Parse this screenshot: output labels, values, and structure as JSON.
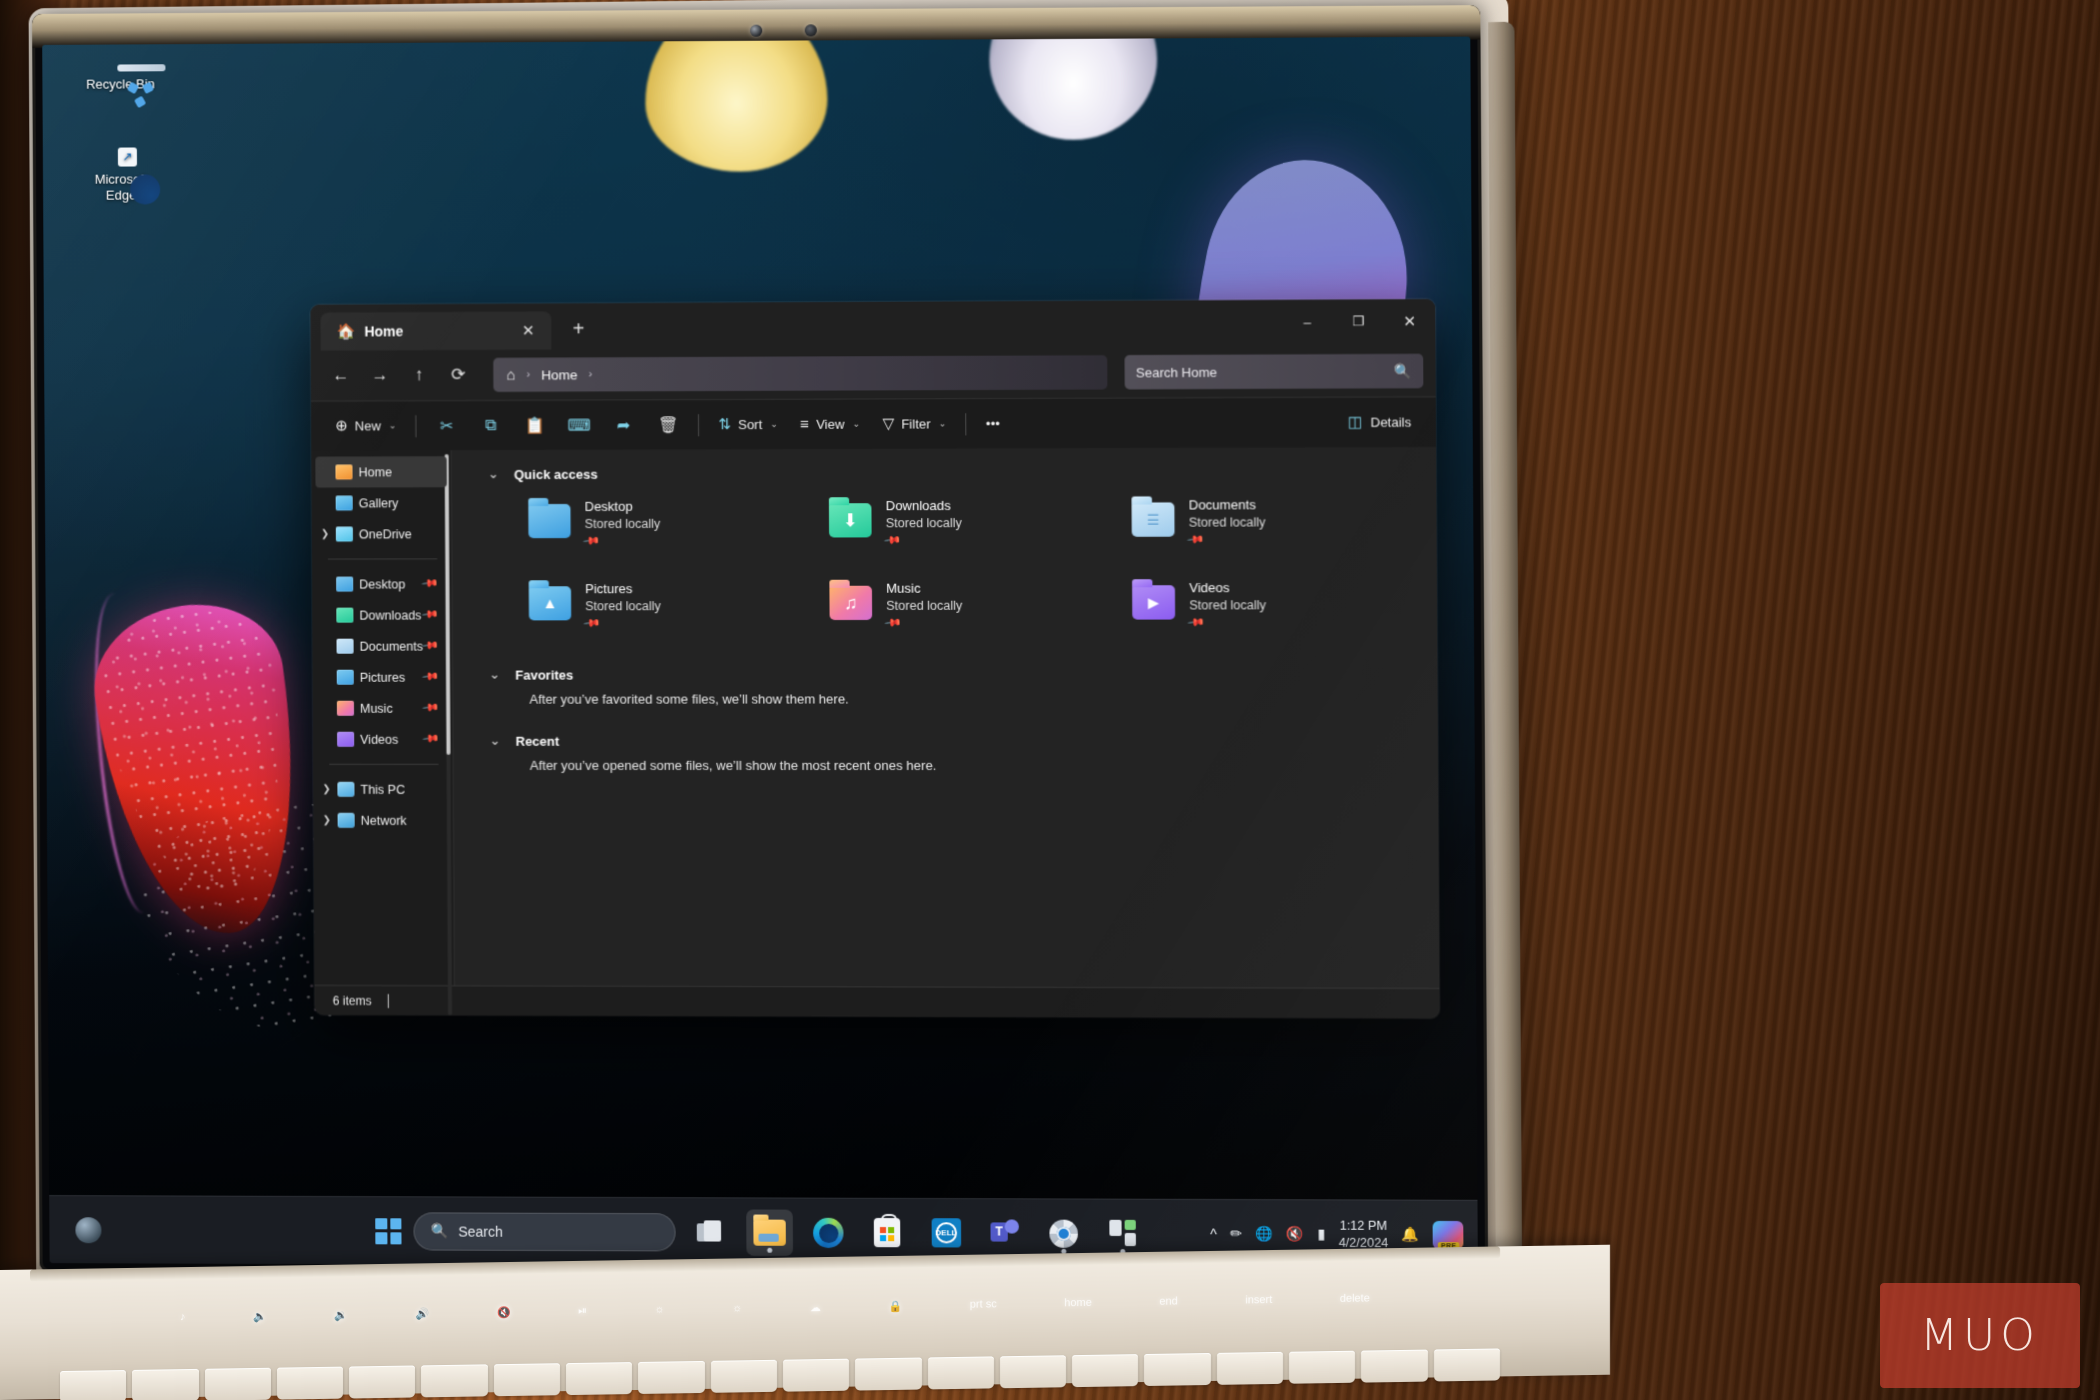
{
  "desktop": {
    "icons": [
      {
        "label": "Recycle Bin",
        "icon": "recycle-bin-icon"
      },
      {
        "label": "Microsoft\nEdge",
        "label_line1": "Microsoft",
        "label_line2": "Edge",
        "icon": "edge-icon"
      }
    ]
  },
  "explorer": {
    "tab": {
      "title": "Home",
      "icon": "home-icon",
      "close_label": "✕",
      "new_tab_label": "+"
    },
    "window_controls": {
      "minimize": "–",
      "maximize": "❐",
      "close": "✕"
    },
    "nav": {
      "back": "←",
      "forward": "→",
      "up": "↑",
      "refresh": "⟳",
      "breadcrumb_home_icon": "home-icon",
      "breadcrumb_sep1": "›",
      "breadcrumb_label": "Home",
      "breadcrumb_sep2": "›"
    },
    "search": {
      "placeholder": "Search Home",
      "icon": "search-icon"
    },
    "toolbar": {
      "new_label": "New",
      "new_icon": "plus-circle-icon",
      "cut_icon": "scissors-icon",
      "copy_icon": "copy-icon",
      "paste_icon": "clipboard-icon",
      "rename_icon": "rename-icon",
      "share_icon": "share-icon",
      "delete_icon": "trash-icon",
      "sort_label": "Sort",
      "sort_icon": "sort-arrows-icon",
      "view_label": "View",
      "view_icon": "view-list-icon",
      "filter_label": "Filter",
      "filter_icon": "funnel-icon",
      "more_label": "•••",
      "details_label": "Details",
      "details_icon": "details-pane-icon",
      "chevron": "⌄"
    },
    "sidebar": [
      {
        "label": "Home",
        "icon": "home-icon",
        "selected": true,
        "expandable": false,
        "pinned": false
      },
      {
        "label": "Gallery",
        "icon": "gallery-icon",
        "selected": false,
        "expandable": false,
        "pinned": false
      },
      {
        "label": "OneDrive",
        "icon": "onedrive-icon",
        "selected": false,
        "expandable": true,
        "pinned": false
      },
      {
        "label": "Desktop",
        "icon": "folder-desktop-icon",
        "selected": false,
        "expandable": false,
        "pinned": true
      },
      {
        "label": "Downloads",
        "icon": "folder-downloads-icon",
        "selected": false,
        "expandable": false,
        "pinned": true
      },
      {
        "label": "Documents",
        "icon": "folder-documents-icon",
        "selected": false,
        "expandable": false,
        "pinned": true
      },
      {
        "label": "Pictures",
        "icon": "folder-pictures-icon",
        "selected": false,
        "expandable": false,
        "pinned": true
      },
      {
        "label": "Music",
        "icon": "folder-music-icon",
        "selected": false,
        "expandable": false,
        "pinned": true
      },
      {
        "label": "Videos",
        "icon": "folder-videos-icon",
        "selected": false,
        "expandable": false,
        "pinned": true
      },
      {
        "label": "This PC",
        "icon": "this-pc-icon",
        "selected": false,
        "expandable": true,
        "pinned": false
      },
      {
        "label": "Network",
        "icon": "network-icon",
        "selected": false,
        "expandable": true,
        "pinned": false
      }
    ],
    "sections": {
      "quick_access": {
        "title": "Quick access",
        "chevron": "⌄",
        "items": [
          {
            "name": "Desktop",
            "status": "Stored locally",
            "pin": "📌",
            "icon": "folder-desktop-icon"
          },
          {
            "name": "Downloads",
            "status": "Stored locally",
            "pin": "📌",
            "icon": "folder-downloads-icon"
          },
          {
            "name": "Documents",
            "status": "Stored locally",
            "pin": "📌",
            "icon": "folder-documents-icon"
          },
          {
            "name": "Pictures",
            "status": "Stored locally",
            "pin": "📌",
            "icon": "folder-pictures-icon"
          },
          {
            "name": "Music",
            "status": "Stored locally",
            "pin": "📌",
            "icon": "folder-music-icon"
          },
          {
            "name": "Videos",
            "status": "Stored locally",
            "pin": "📌",
            "icon": "folder-videos-icon"
          }
        ]
      },
      "favorites": {
        "title": "Favorites",
        "chevron": "⌄",
        "empty_text": "After you’ve favorited some files, we’ll show them here."
      },
      "recent": {
        "title": "Recent",
        "chevron": "⌄",
        "empty_text": "After you’ve opened some files, we’ll show the most recent ones here."
      }
    },
    "status_bar": {
      "item_count": "6 items"
    }
  },
  "taskbar": {
    "start_label": "start-icon",
    "search": {
      "placeholder": "Search",
      "icon": "search-icon"
    },
    "apps": [
      {
        "name": "task-view-icon",
        "active": false,
        "running": false
      },
      {
        "name": "file-explorer-icon",
        "active": true,
        "running": true
      },
      {
        "name": "edge-icon",
        "active": false,
        "running": false
      },
      {
        "name": "microsoft-store-icon",
        "active": false,
        "running": false
      },
      {
        "name": "dell-icon",
        "active": false,
        "running": false,
        "badge": "DELL"
      },
      {
        "name": "teams-icon",
        "active": false,
        "running": false,
        "badge": "T"
      },
      {
        "name": "settings-icon",
        "active": false,
        "running": true
      },
      {
        "name": "widgets-icon",
        "active": false,
        "running": true
      }
    ],
    "tray": {
      "show_hidden_icon": "chevron-up-icon",
      "pen_icon": "pen-disabled-icon",
      "network_icon": "globe-no-internet-icon",
      "volume_icon": "speaker-muted-icon",
      "battery_icon": "battery-icon",
      "time": "1:12 PM",
      "date": "4/2/2024",
      "notification_icon": "bell-icon",
      "copilot_icon": "copilot-icon",
      "copilot_badge": "PRE"
    }
  },
  "watermark": {
    "text": "MUO"
  },
  "colors": {
    "accent": "#5cb5ef",
    "window_bg": "#232323",
    "sidebar_bg": "#1c1c1c",
    "toolbar_icon": "#7fd4ea",
    "watermark": "#c43e2e"
  }
}
